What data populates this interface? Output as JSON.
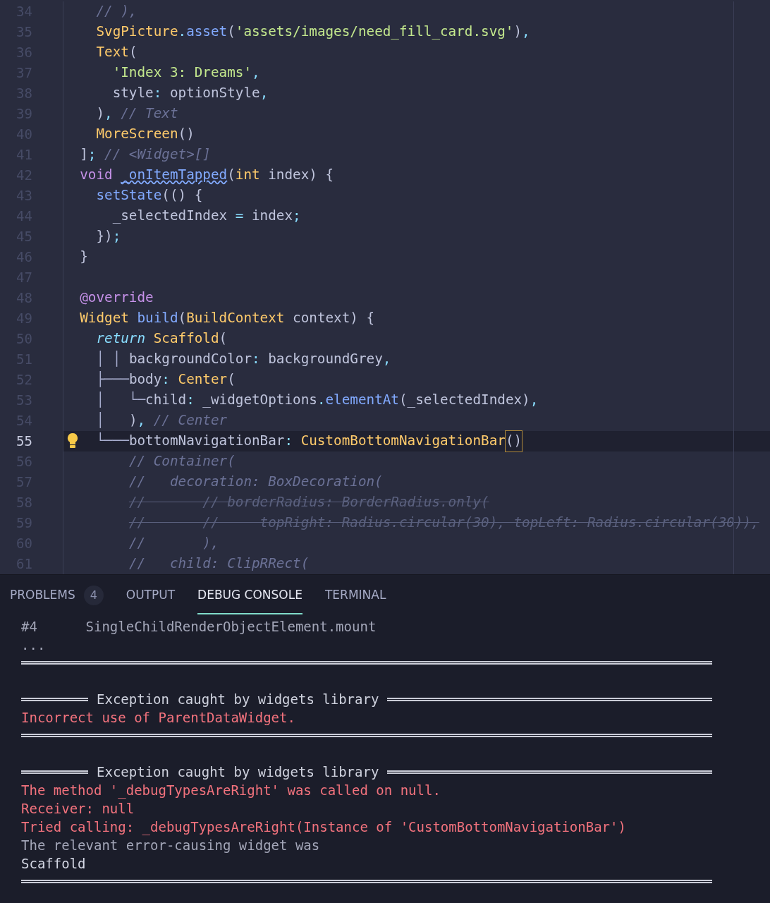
{
  "editor": {
    "lines": [
      {
        "number": "34",
        "tokens": [
          {
            "kind": "comment",
            "text": "    // ),"
          }
        ]
      },
      {
        "number": "35",
        "tokens": [
          {
            "kind": "type",
            "text": "    SvgPicture"
          },
          {
            "kind": "punct",
            "text": "."
          },
          {
            "kind": "func",
            "text": "asset"
          },
          {
            "kind": "plain",
            "text": "("
          },
          {
            "kind": "string",
            "text": "'assets/images/need_fill_card.svg'"
          },
          {
            "kind": "plain",
            "text": ")"
          },
          {
            "kind": "punct",
            "text": ","
          }
        ]
      },
      {
        "number": "36",
        "tokens": [
          {
            "kind": "type",
            "text": "    Text"
          },
          {
            "kind": "plain",
            "text": "("
          }
        ]
      },
      {
        "number": "37",
        "tokens": [
          {
            "kind": "string",
            "text": "      'Index 3: Dreams'"
          },
          {
            "kind": "punct",
            "text": ","
          }
        ]
      },
      {
        "number": "38",
        "tokens": [
          {
            "kind": "plain",
            "text": "      style"
          },
          {
            "kind": "punct",
            "text": ":"
          },
          {
            "kind": "plain",
            "text": " optionStyle"
          },
          {
            "kind": "punct",
            "text": ","
          }
        ]
      },
      {
        "number": "39",
        "tokens": [
          {
            "kind": "plain",
            "text": "    )"
          },
          {
            "kind": "punct",
            "text": ","
          },
          {
            "kind": "comment",
            "text": " // Text"
          }
        ]
      },
      {
        "number": "40",
        "tokens": [
          {
            "kind": "type",
            "text": "    MoreScreen"
          },
          {
            "kind": "plain",
            "text": "()"
          }
        ]
      },
      {
        "number": "41",
        "tokens": [
          {
            "kind": "plain",
            "text": "  ]"
          },
          {
            "kind": "punct",
            "text": ";"
          },
          {
            "kind": "comment",
            "text": " // <Widget>[]"
          }
        ]
      },
      {
        "number": "42",
        "tokens": [
          {
            "kind": "keyword",
            "text": "  void"
          },
          {
            "kind": "squiggle",
            "text": " _onItemTapped"
          },
          {
            "kind": "plain",
            "text": "("
          },
          {
            "kind": "type",
            "text": "int"
          },
          {
            "kind": "plain",
            "text": " index) {"
          }
        ]
      },
      {
        "number": "43",
        "tokens": [
          {
            "kind": "func",
            "text": "    setState"
          },
          {
            "kind": "plain",
            "text": "(() {"
          }
        ]
      },
      {
        "number": "44",
        "tokens": [
          {
            "kind": "plain",
            "text": "      _selectedIndex"
          },
          {
            "kind": "punct",
            "text": " = "
          },
          {
            "kind": "plain",
            "text": "index"
          },
          {
            "kind": "punct",
            "text": ";"
          }
        ]
      },
      {
        "number": "45",
        "tokens": [
          {
            "kind": "plain",
            "text": "    })"
          },
          {
            "kind": "punct",
            "text": ";"
          }
        ]
      },
      {
        "number": "46",
        "tokens": [
          {
            "kind": "plain",
            "text": "  }"
          }
        ]
      },
      {
        "number": "47"
      },
      {
        "number": "48",
        "tokens": [
          {
            "kind": "keyword",
            "text": "  @override"
          }
        ]
      },
      {
        "number": "49",
        "tokens": [
          {
            "kind": "type",
            "text": "  Widget"
          },
          {
            "kind": "func",
            "text": " build"
          },
          {
            "kind": "plain",
            "text": "("
          },
          {
            "kind": "type",
            "text": "BuildContext"
          },
          {
            "kind": "plain",
            "text": " context) {"
          }
        ]
      },
      {
        "number": "50",
        "tokens": [
          {
            "kind": "control",
            "text": "    return"
          },
          {
            "kind": "type",
            "text": " Scaffold"
          },
          {
            "kind": "plain",
            "text": "("
          }
        ]
      },
      {
        "number": "51",
        "tokens": [
          {
            "kind": "guide",
            "text": "    │ │ "
          },
          {
            "kind": "plain",
            "text": "backgroundColor"
          },
          {
            "kind": "punct",
            "text": ":"
          },
          {
            "kind": "plain",
            "text": " backgroundGrey"
          },
          {
            "kind": "punct",
            "text": ","
          }
        ]
      },
      {
        "number": "52",
        "tokens": [
          {
            "kind": "guide",
            "text": "    ├───"
          },
          {
            "kind": "plain",
            "text": "body"
          },
          {
            "kind": "punct",
            "text": ":"
          },
          {
            "kind": "type",
            "text": " Center"
          },
          {
            "kind": "plain",
            "text": "("
          }
        ]
      },
      {
        "number": "53",
        "tokens": [
          {
            "kind": "guide",
            "text": "    │   └─"
          },
          {
            "kind": "plain",
            "text": "child"
          },
          {
            "kind": "punct",
            "text": ":"
          },
          {
            "kind": "plain",
            "text": " _widgetOptions"
          },
          {
            "kind": "punct",
            "text": "."
          },
          {
            "kind": "func",
            "text": "elementAt"
          },
          {
            "kind": "plain",
            "text": "(_selectedIndex)"
          },
          {
            "kind": "punct",
            "text": ","
          }
        ]
      },
      {
        "number": "54",
        "tokens": [
          {
            "kind": "guide",
            "text": "    │   "
          },
          {
            "kind": "plain",
            "text": ")"
          },
          {
            "kind": "punct",
            "text": ","
          },
          {
            "kind": "comment",
            "text": " // Center"
          }
        ]
      },
      {
        "number": "55",
        "current": true,
        "tokens": [
          {
            "kind": "guide",
            "text": "    └───"
          },
          {
            "kind": "plain",
            "text": "bottomNavigationBar"
          },
          {
            "kind": "punct",
            "text": ":"
          },
          {
            "kind": "type",
            "text": " CustomBottomNavigationBar"
          },
          {
            "kind": "matched",
            "text": "()"
          }
        ]
      },
      {
        "number": "56",
        "tokens": [
          {
            "kind": "comment",
            "text": "        // Container("
          }
        ]
      },
      {
        "number": "57",
        "tokens": [
          {
            "kind": "comment",
            "text": "        //   decoration: BoxDecoration("
          }
        ]
      },
      {
        "number": "58",
        "tokens": [
          {
            "kind": "struck",
            "text": "        //       // borderRadius: BorderRadius.only("
          }
        ]
      },
      {
        "number": "59",
        "tokens": [
          {
            "kind": "struck",
            "text": "        //       //     topRight: Radius.circular(30), topLeft: Radius.circular(30)),"
          }
        ]
      },
      {
        "number": "60",
        "tokens": [
          {
            "kind": "comment",
            "text": "        //       ),"
          }
        ]
      },
      {
        "number": "61",
        "tokens": [
          {
            "kind": "comment",
            "text": "        //   child: ClipRRect("
          }
        ]
      }
    ]
  },
  "panel": {
    "tabs": [
      {
        "label": "PROBLEMS",
        "badge": "4",
        "selected": false
      },
      {
        "label": "OUTPUT",
        "selected": false
      },
      {
        "label": "DEBUG CONSOLE",
        "selected": true
      },
      {
        "label": "TERMINAL",
        "selected": false
      }
    ],
    "console": [
      {
        "kind": "note",
        "text": "#4      SingleChildRenderObjectElement.mount"
      },
      {
        "kind": "note",
        "text": "..."
      },
      {
        "kind": "rule"
      },
      {
        "kind": "gap"
      },
      {
        "kind": "heading",
        "text": "Exception caught by widgets library"
      },
      {
        "kind": "error",
        "text": "Incorrect use of ParentDataWidget."
      },
      {
        "kind": "rule"
      },
      {
        "kind": "gap"
      },
      {
        "kind": "heading",
        "text": "Exception caught by widgets library"
      },
      {
        "kind": "error",
        "text": "The method '_debugTypesAreRight' was called on null."
      },
      {
        "kind": "error",
        "text": "Receiver: null"
      },
      {
        "kind": "error",
        "text": "Tried calling: _debugTypesAreRight(Instance of 'CustomBottomNavigationBar')"
      },
      {
        "kind": "note",
        "text": "The relevant error-causing widget was"
      },
      {
        "kind": "value",
        "text": "Scaffold"
      },
      {
        "kind": "rule"
      }
    ]
  }
}
